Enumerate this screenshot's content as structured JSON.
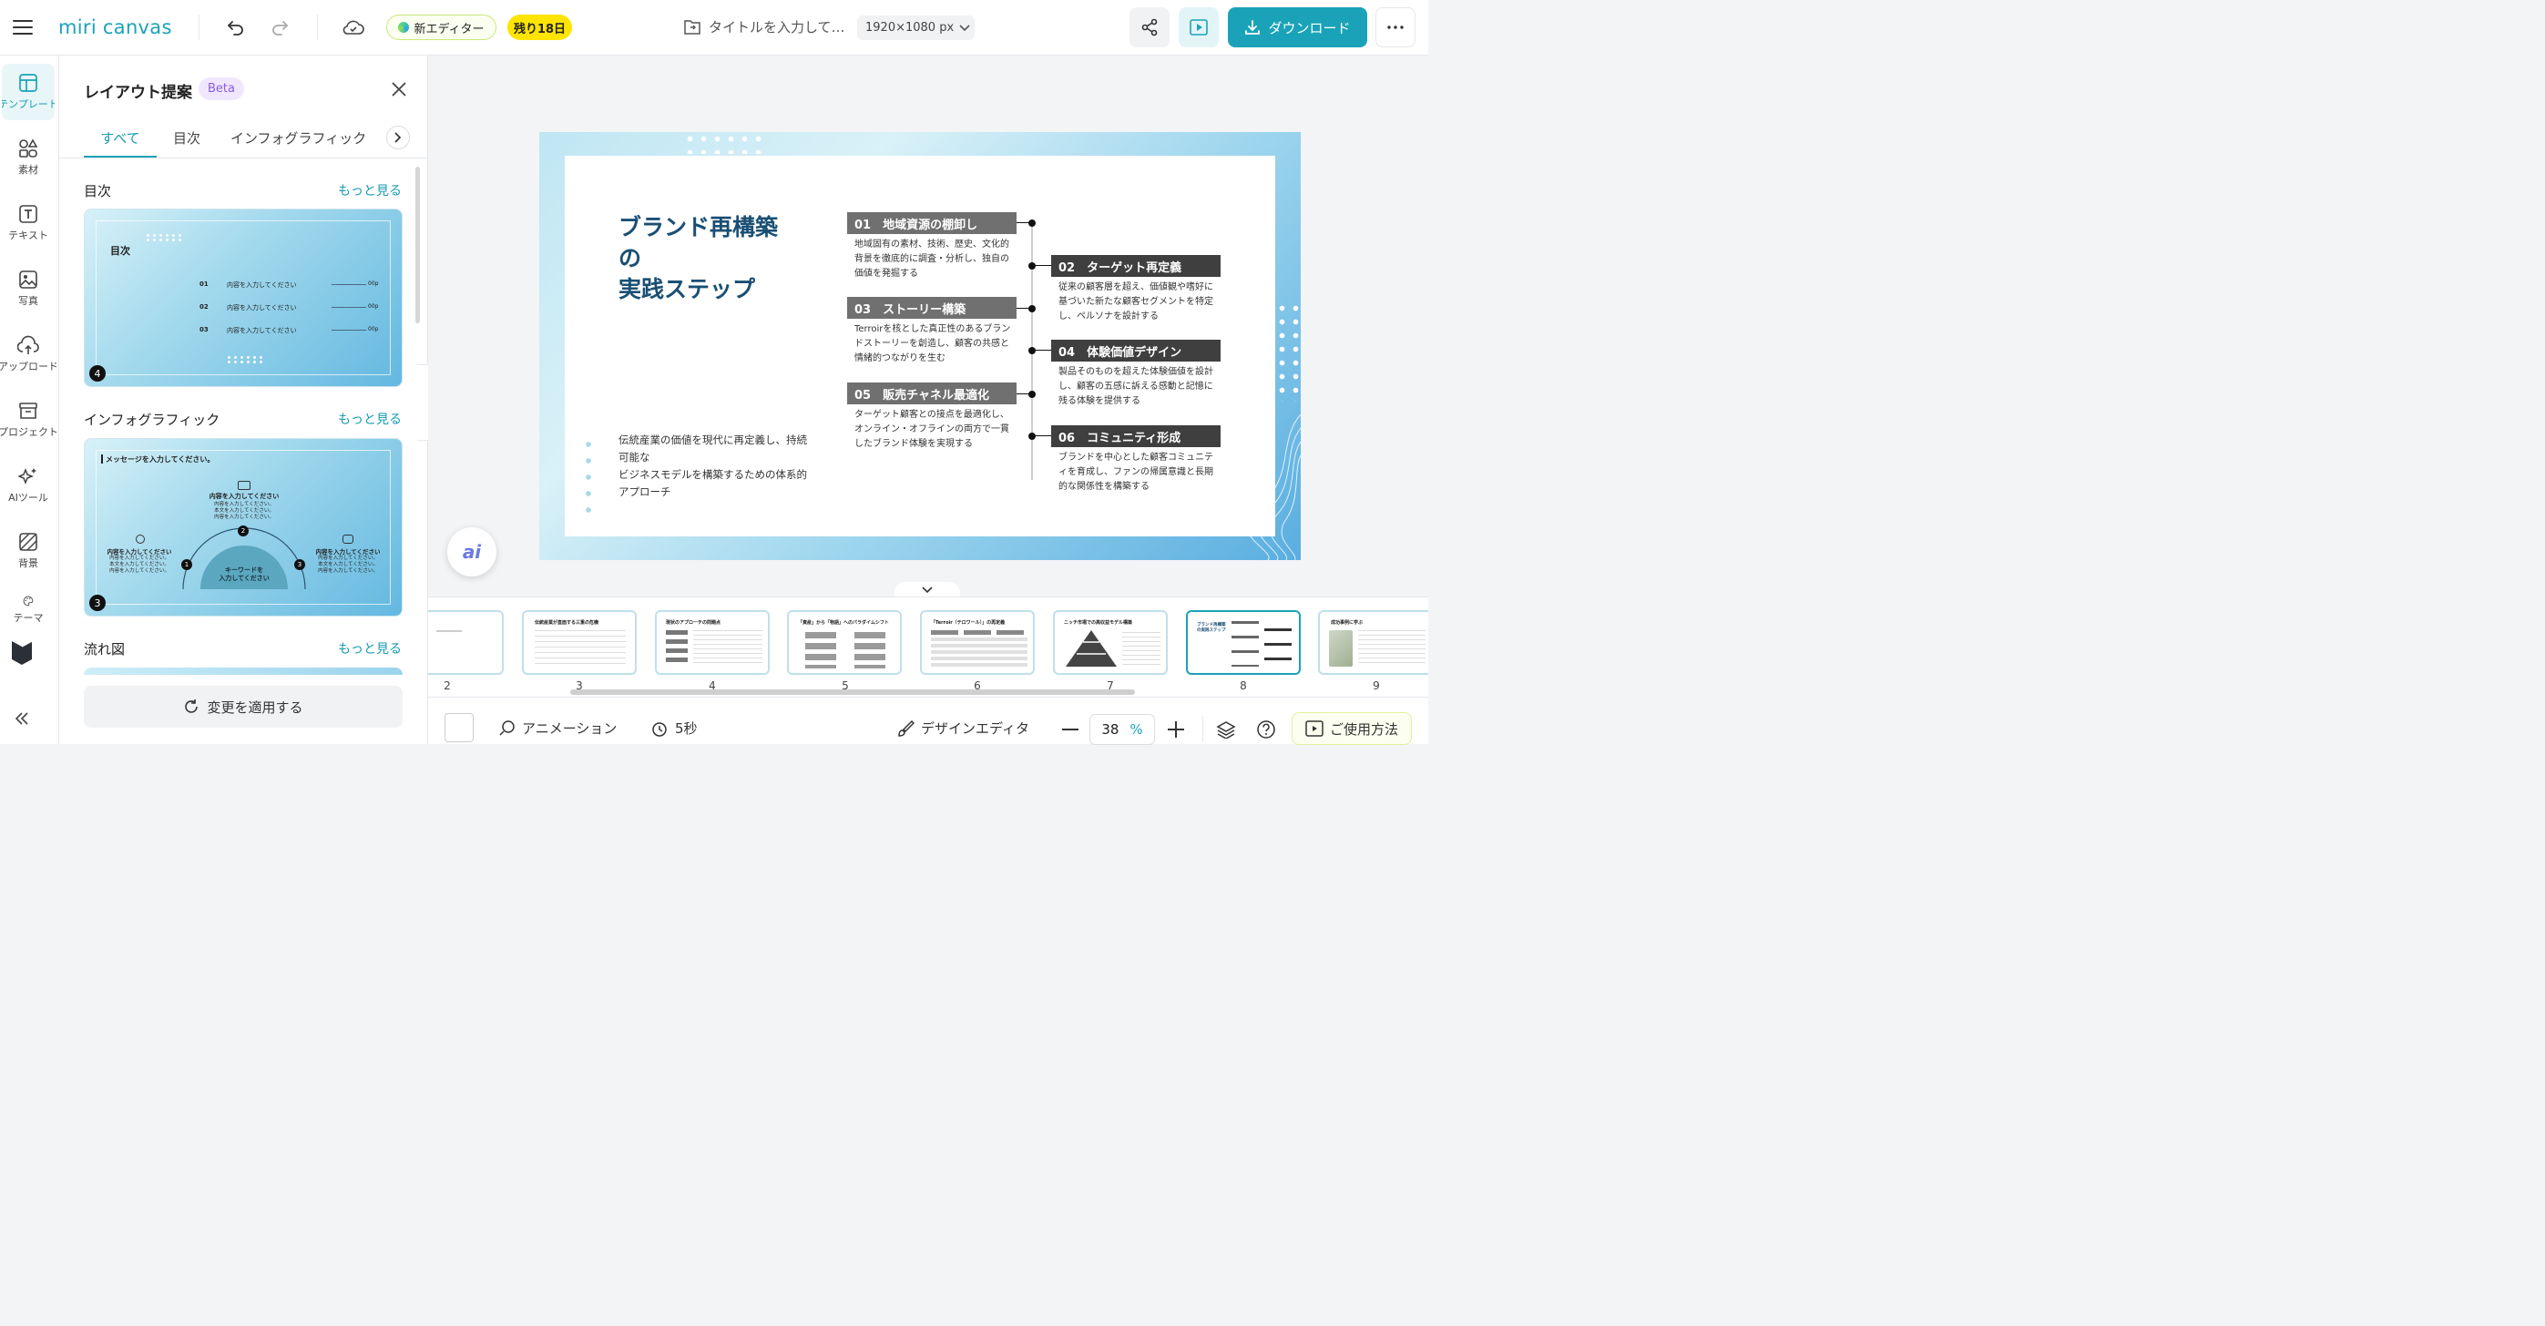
{
  "header": {
    "logo": "miri canvas",
    "new_editor": "新エディター",
    "trial": "残り18日",
    "doc_title": "タイトルを入力して…",
    "size_label": "1920×1080 px",
    "download": "ダウンロード"
  },
  "rail": {
    "items": [
      {
        "label": "テンプレート",
        "icon": "template-icon"
      },
      {
        "label": "素材",
        "icon": "elements-icon"
      },
      {
        "label": "テキスト",
        "icon": "text-icon"
      },
      {
        "label": "写真",
        "icon": "photo-icon"
      },
      {
        "label": "アップロード",
        "icon": "upload-icon"
      },
      {
        "label": "プロジェクト",
        "icon": "project-icon"
      },
      {
        "label": "AIツール",
        "icon": "ai-tool-icon"
      },
      {
        "label": "背景",
        "icon": "background-icon"
      },
      {
        "label": "テーマ",
        "icon": "theme-icon"
      }
    ]
  },
  "panel": {
    "title": "レイアウト提案",
    "beta": "Beta",
    "tabs": [
      "すべて",
      "目次",
      "インフォグラフィック"
    ],
    "sections": [
      {
        "title": "目次",
        "more": "もっと見る"
      },
      {
        "title": "インフォグラフィック",
        "more": "もっと見る"
      },
      {
        "title": "流れ図",
        "more": "もっと見る"
      }
    ],
    "card1": {
      "heading": "目次",
      "rows": [
        {
          "num": "01",
          "text": "内容を入力してください",
          "page": "00p"
        },
        {
          "num": "02",
          "text": "内容を入力してください",
          "page": "00p"
        },
        {
          "num": "03",
          "text": "内容を入力してください",
          "page": "00p"
        }
      ],
      "badge": "4"
    },
    "card2": {
      "message": "メッセージを入力してください。",
      "center_title": "内容を入力してください",
      "center_lines": [
        "内容を入力してください。",
        "本文を入力してください。",
        "内容を入力してください。"
      ],
      "left_title": "内容を入力してください",
      "left_lines": [
        "内容を入力してください。",
        "本文を入力してください。",
        "内容を入力してください。"
      ],
      "right_title": "内容を入力してください",
      "right_lines": [
        "内容を入力してください。",
        "本文を入力してください。",
        "内容を入力してください。"
      ],
      "keyword": [
        "キーワードを",
        "入力してください"
      ],
      "nums": [
        "1",
        "2",
        "3"
      ],
      "badge": "3"
    },
    "apply": "変更を適用する"
  },
  "slide": {
    "title": [
      "ブランド再構築",
      "の",
      "実践ステップ"
    ],
    "subtitle": [
      "伝統産業の価値を現代に再定義し、持続",
      "可能な",
      "ビジネスモデルを構築するための体系的",
      "アプローチ"
    ],
    "steps": [
      {
        "label": "01　地域資源の棚卸し",
        "desc": [
          "地域固有の素材、技術、歴史、文化的",
          "背景を徹底的に調査・分析し、独自の",
          "価値を発掘する"
        ]
      },
      {
        "label": "02　ターゲット再定義",
        "desc": [
          "従来の顧客層を超え、価値観や嗜好に",
          "基づいた新たな顧客セグメントを特定",
          "し、ペルソナを設計する"
        ]
      },
      {
        "label": "03　ストーリー構築",
        "desc": [
          "Terroirを核とした真正性のあるブラン",
          "ドストーリーを創造し、顧客の共感と",
          "情緒的つながりを生む"
        ]
      },
      {
        "label": "04　体験価値デザイン",
        "desc": [
          "製品そのものを超えた体験価値を設計",
          "し、顧客の五感に訴える感動と記憶に",
          "残る体験を提供する"
        ]
      },
      {
        "label": "05　販売チャネル最適化",
        "desc": [
          "ターゲット顧客との接点を最適化し、",
          "オンライン・オフラインの両方で一貫",
          "したブランド体験を実現する"
        ]
      },
      {
        "label": "06　コミュニティ形成",
        "desc": [
          "ブランドを中心とした顧客コミュニテ",
          "ィを育成し、ファンの帰属意識と長期",
          "的な関係性を構築する"
        ]
      }
    ],
    "colors": {
      "step_odd": "#707070",
      "step_even": "#3f3f3f",
      "title": "#1a4f74"
    }
  },
  "filmstrip": {
    "pages": [
      {
        "num": "2",
        "title": ""
      },
      {
        "num": "3",
        "title": "伝統産業が直面する三重の危機"
      },
      {
        "num": "4",
        "title": "現状のアプローチの問題点"
      },
      {
        "num": "5",
        "title": "「資産」から「物語」へのパラダイムシフト"
      },
      {
        "num": "6",
        "title": "「Terroir（テロワール）」の再定義"
      },
      {
        "num": "7",
        "title": "ニッチ市場での高収益モデル構築"
      },
      {
        "num": "8",
        "title": "ブランド再構築の実践ステップ"
      },
      {
        "num": "9",
        "title": "成功事例に学ぶ"
      }
    ],
    "selected": "8"
  },
  "bottom": {
    "animation": "アニメーション",
    "duration": "5秒",
    "design_editor": "デザインエディタ",
    "zoom": "38",
    "zoom_unit": "%",
    "help": "ご使用方法"
  }
}
